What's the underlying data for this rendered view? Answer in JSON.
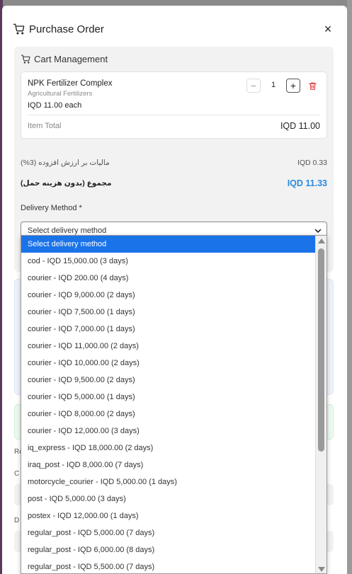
{
  "modal": {
    "title": "Purchase Order",
    "close_icon": "close-icon",
    "close_label": "×"
  },
  "cart": {
    "heading": "Cart Management",
    "item": {
      "name": "NPK Fertilizer Complex",
      "category": "Agricultural Fertilizers",
      "price_each": "IQD 11.00 each",
      "quantity": "1",
      "minus_label": "−",
      "plus_label": "+",
      "total_label": "Item Total",
      "total_value": "IQD 11.00"
    },
    "vat_label": "مالیات بر ارزش افزوده (3%)",
    "vat_value": "IQD 0.33",
    "subtotal_label": "مجموع (بدون هزینه حمل)",
    "subtotal_value": "IQD 11.33"
  },
  "delivery": {
    "label": "Delivery Method *",
    "selected": "Select delivery method",
    "options": [
      "Select delivery method",
      "cod - IQD 15,000.00 (3 days)",
      "courier - IQD 200.00 (4 days)",
      "courier - IQD 9,000.00 (2 days)",
      "courier - IQD 7,500.00 (1 days)",
      "courier - IQD 7,000.00 (1 days)",
      "courier - IQD 11,000.00 (2 days)",
      "courier - IQD 10,000.00 (2 days)",
      "courier - IQD 9,500.00 (2 days)",
      "courier - IQD 5,000.00 (1 days)",
      "courier - IQD 8,000.00 (2 days)",
      "courier - IQD 12,000.00 (3 days)",
      "iq_express - IQD 18,000.00 (2 days)",
      "iraq_post - IQD 8,000.00 (7 days)",
      "motorcycle_courier - IQD 5,000.00 (1 days)",
      "post - IQD 5,000.00 (3 days)",
      "postex - IQD 12,000.00 (1 days)",
      "regular_post - IQD 5,000.00 (7 days)",
      "regular_post - IQD 6,000.00 (8 days)",
      "regular_post - IQD 5,500.00 (7 days)"
    ]
  },
  "background_fragments": {
    "frag_re": "Re",
    "frag_c": "C",
    "frag_d": "D"
  },
  "colors": {
    "accent_blue": "#2b8be0",
    "selected_option": "#1a73e8",
    "danger": "#e03131"
  }
}
